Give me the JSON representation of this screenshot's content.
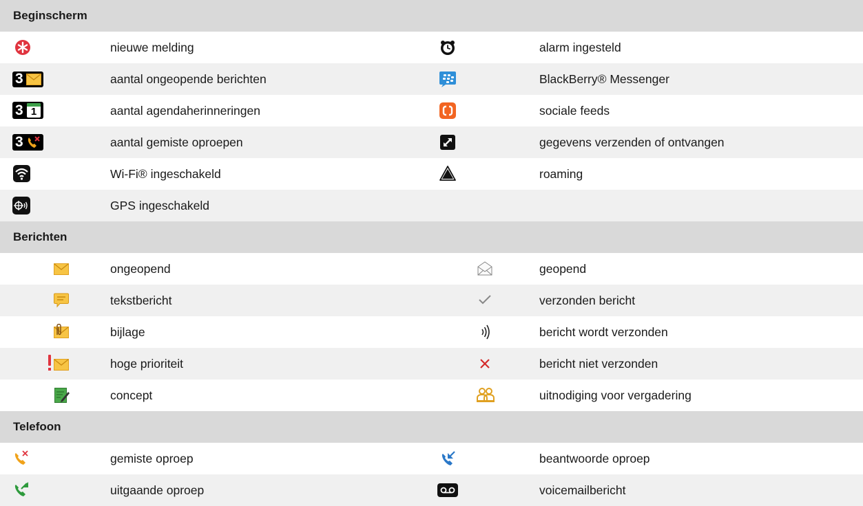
{
  "sections": {
    "home": {
      "title": "Beginscherm",
      "rows": [
        {
          "left": {
            "icon": "new-notification-icon",
            "label": "nieuwe melding"
          },
          "right": {
            "icon": "alarm-clock-icon",
            "label": "alarm ingesteld"
          }
        },
        {
          "left": {
            "icon": "unopened-messages-count-icon",
            "count": "3",
            "label": "aantal ongeopende berichten"
          },
          "right": {
            "icon": "bbm-icon",
            "label": "BlackBerry® Messenger"
          }
        },
        {
          "left": {
            "icon": "calendar-reminders-count-icon",
            "count": "3",
            "calendar_day": "1",
            "label": "aantal agendaherinneringen"
          },
          "right": {
            "icon": "social-feeds-icon",
            "label": "sociale feeds"
          }
        },
        {
          "left": {
            "icon": "missed-calls-count-icon",
            "count": "3",
            "label": "aantal gemiste oproepen"
          },
          "right": {
            "icon": "data-transfer-icon",
            "label": "gegevens verzenden of ontvangen"
          }
        },
        {
          "left": {
            "icon": "wifi-icon",
            "label": "Wi-Fi® ingeschakeld"
          },
          "right": {
            "icon": "roaming-icon",
            "label": "roaming"
          }
        },
        {
          "left": {
            "icon": "gps-icon",
            "label": "GPS ingeschakeld"
          }
        }
      ]
    },
    "messages": {
      "title": "Berichten",
      "rows": [
        {
          "left": {
            "icon": "unopened-envelope-icon",
            "label": "ongeopend"
          },
          "right": {
            "icon": "opened-envelope-icon",
            "label": "geopend"
          }
        },
        {
          "left": {
            "icon": "text-message-icon",
            "label": "tekstbericht"
          },
          "right": {
            "icon": "checkmark-icon",
            "label": "verzonden bericht"
          }
        },
        {
          "left": {
            "icon": "attachment-envelope-icon",
            "label": "bijlage"
          },
          "right": {
            "icon": "sending-waves-icon",
            "label": "bericht wordt verzonden"
          }
        },
        {
          "left": {
            "icon": "high-priority-envelope-icon",
            "label": "hoge prioriteit"
          },
          "right": {
            "icon": "not-sent-x-icon",
            "label": "bericht niet verzonden"
          }
        },
        {
          "left": {
            "icon": "draft-icon",
            "label": "concept"
          },
          "right": {
            "icon": "meeting-invitation-icon",
            "label": "uitnodiging voor vergadering"
          }
        }
      ]
    },
    "phone": {
      "title": "Telefoon",
      "rows": [
        {
          "left": {
            "icon": "missed-call-icon",
            "label": "gemiste oproep"
          },
          "right": {
            "icon": "answered-call-icon",
            "label": "beantwoorde oproep"
          }
        },
        {
          "left": {
            "icon": "outgoing-call-icon",
            "label": "uitgaande oproep"
          },
          "right": {
            "icon": "voicemail-icon",
            "label": "voicemailbericht"
          }
        }
      ]
    }
  },
  "colors": {
    "header_bg": "#d9d9d9",
    "stripe_bg": "#f0f0f0",
    "notification_red": "#e0343f",
    "envelope_yellow": "#f7c444",
    "bbm_blue": "#2f8fd8",
    "social_orange": "#f26522",
    "call_orange": "#f0a21a",
    "call_blue": "#2a78c8",
    "call_green": "#2e9a3c",
    "draft_green": "#4aa84a",
    "error_red": "#d42a2a"
  }
}
